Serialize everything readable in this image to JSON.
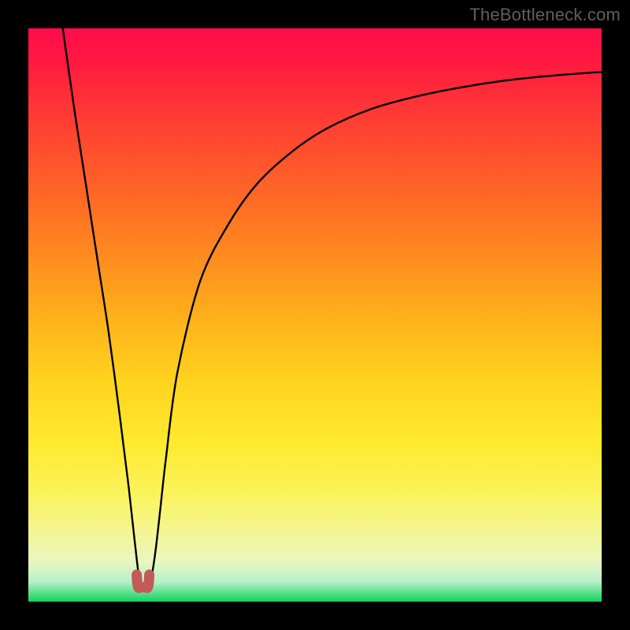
{
  "watermark": "TheBottleneck.com",
  "chart_data": {
    "type": "line",
    "title": "",
    "xlabel": "",
    "ylabel": "",
    "xlim": [
      0,
      100
    ],
    "ylim": [
      0,
      100
    ],
    "series": [
      {
        "name": "curve",
        "x": [
          6,
          8,
          10,
          12,
          14,
          16,
          17.5,
          18.5,
          19.2,
          19.7,
          20.2,
          20.8,
          21.5,
          22.2,
          23,
          24,
          26,
          30,
          35,
          40,
          46,
          52,
          60,
          68,
          76,
          84,
          92,
          100
        ],
        "y": [
          100,
          86,
          73,
          60,
          47,
          32,
          20,
          11,
          5,
          2.5,
          2.2,
          2.6,
          4.5,
          9,
          16,
          25,
          40,
          56,
          66,
          73,
          78.5,
          82.5,
          86,
          88.2,
          89.8,
          91,
          91.8,
          92.4
        ]
      }
    ],
    "marker": {
      "x": 20,
      "y": 2.5,
      "shape": "u",
      "width_x": 2.2,
      "height_y": 4
    },
    "background_gradient": {
      "top": "#ff0d4b",
      "bottom": "#11d160"
    }
  }
}
